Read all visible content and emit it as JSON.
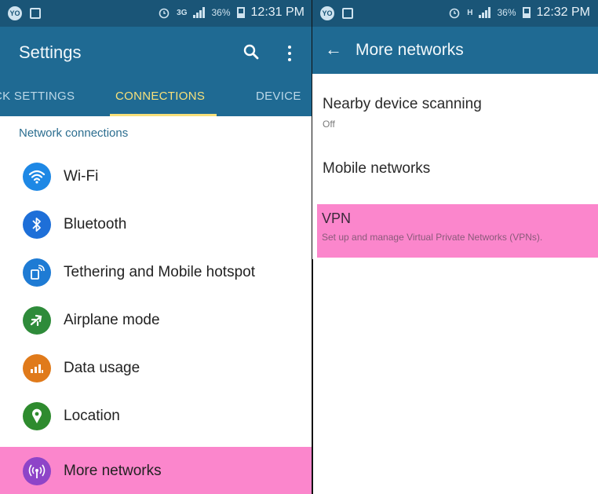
{
  "left": {
    "status": {
      "net": "3G",
      "battery": "36%",
      "time": "12:31 PM"
    },
    "title": "Settings",
    "tabs": [
      "CK SETTINGS",
      "CONNECTIONS",
      "DEVICE"
    ],
    "section_header": "Network connections",
    "items": [
      {
        "label": "Wi-Fi",
        "icon": "wifi-icon",
        "color": "#1e88e5"
      },
      {
        "label": "Bluetooth",
        "icon": "bluetooth-icon",
        "color": "#1e6fd8"
      },
      {
        "label": "Tethering and Mobile hotspot",
        "icon": "hotspot-icon",
        "color": "#1e7bd4"
      },
      {
        "label": "Airplane mode",
        "icon": "airplane-icon",
        "color": "#2e8b3a"
      },
      {
        "label": "Data usage",
        "icon": "data-usage-icon",
        "color": "#e07a1a"
      },
      {
        "label": "Location",
        "icon": "location-icon",
        "color": "#2e8b2e"
      },
      {
        "label": "More networks",
        "icon": "more-networks-icon",
        "color": "#8e44c8",
        "highlighted": true
      }
    ]
  },
  "right": {
    "status": {
      "net": "H",
      "battery": "36%",
      "time": "12:32 PM"
    },
    "title": "More networks",
    "items": [
      {
        "title": "Nearby device scanning",
        "subtitle": "Off"
      },
      {
        "title": "Mobile networks"
      },
      {
        "title": "VPN",
        "subtitle": "Set up and manage Virtual Private Networks (VPNs).",
        "highlighted": true
      }
    ]
  },
  "colors": {
    "status_bar": "#1a5577",
    "app_bar": "#1f6a93",
    "tab_active": "#f7e07a",
    "highlight": "#fb86cc"
  }
}
